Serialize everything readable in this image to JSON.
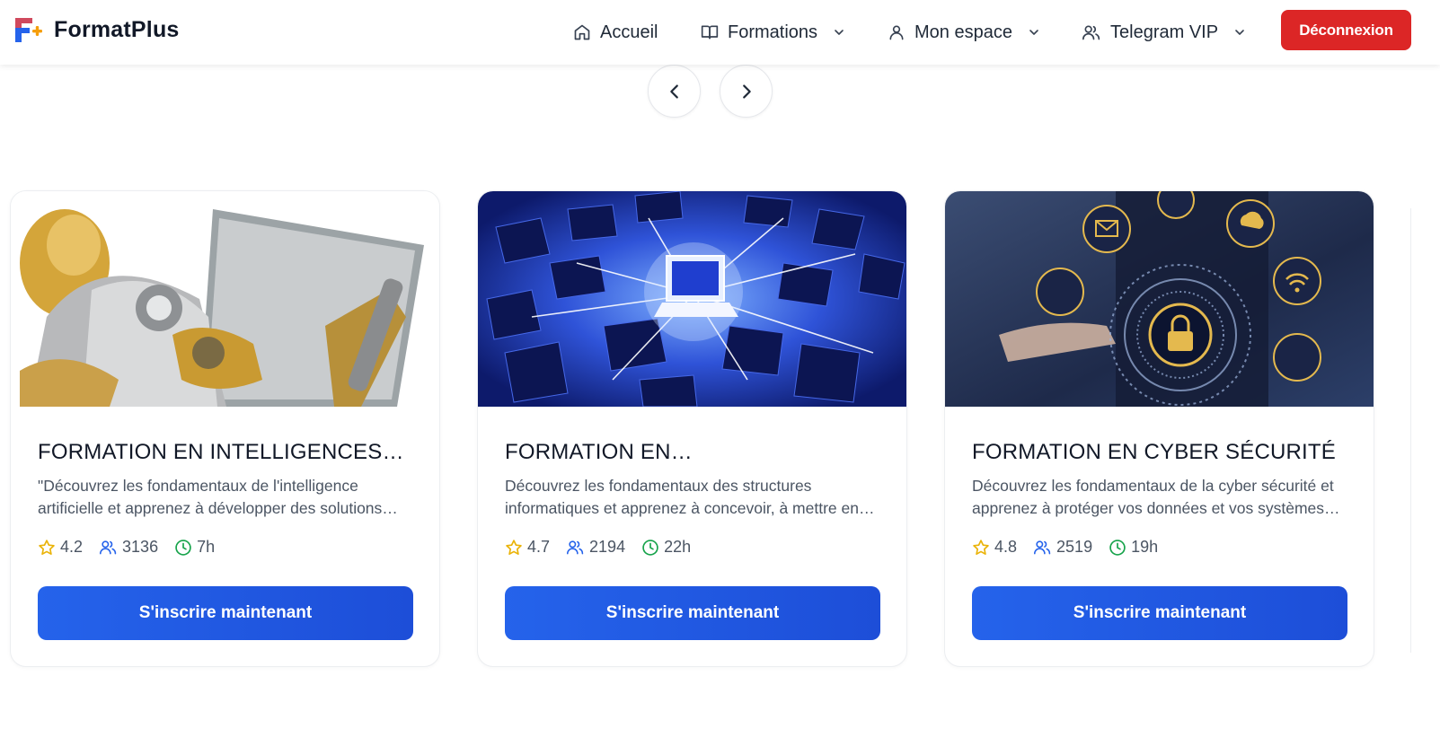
{
  "brand": {
    "name": "FormatPlus",
    "accent": "#dc2626",
    "primary": "#2563eb"
  },
  "nav": {
    "items": [
      {
        "label": "Accueil",
        "icon": "home-icon"
      },
      {
        "label": "Formations",
        "icon": "book-icon",
        "dropdown": true
      },
      {
        "label": "Mon espace",
        "icon": "user-icon",
        "dropdown": true
      },
      {
        "label": "Telegram VIP",
        "icon": "users-icon",
        "dropdown": true
      }
    ],
    "logout_label": "Déconnexion"
  },
  "carousel": {
    "prev_icon": "chevron-left-icon",
    "next_icon": "chevron-right-icon"
  },
  "courses": [
    {
      "title": "FORMATION EN INTELLIGENCES…",
      "desc_line1": "\"Découvrez les fondamentaux de l'intelligence",
      "desc_line2": "artificielle et apprenez à développer des solutions…",
      "rating": "4.2",
      "students": "3136",
      "duration": "7h",
      "cta": "S'inscrire maintenant",
      "image": "robot-image"
    },
    {
      "title": "FORMATION EN…",
      "desc_line1": "Découvrez les fondamentaux des structures",
      "desc_line2": "informatiques et apprenez à concevoir, à mettre en…",
      "rating": "4.7",
      "students": "2194",
      "duration": "22h",
      "cta": "S'inscrire maintenant",
      "image": "network-image"
    },
    {
      "title": "FORMATION EN CYBER SÉCURITÉ",
      "desc_line1": "Découvrez les fondamentaux de la cyber sécurité et",
      "desc_line2": "apprenez à protéger vos données et vos systèmes…",
      "rating": "4.8",
      "students": "2519",
      "duration": "19h",
      "cta": "S'inscrire maintenant",
      "image": "security-image"
    }
  ]
}
